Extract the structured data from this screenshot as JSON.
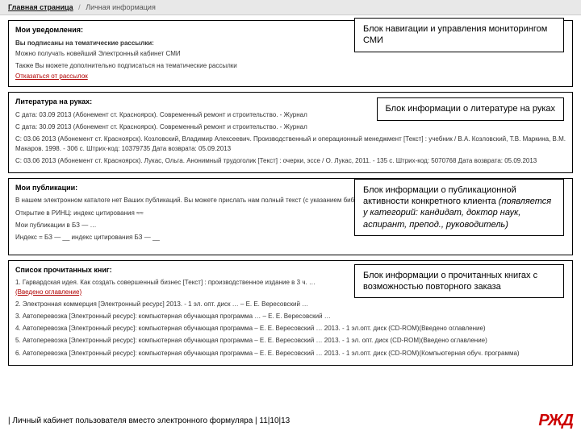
{
  "breadcrumb": {
    "main": "Главная страница",
    "current": "Личная информация"
  },
  "nav": {
    "title": "Мои уведомления:",
    "l1": "Вы подписаны на тематические рассылки:",
    "l2": "Можно получать новейший Электронный кабинет СМИ",
    "l3": "Также Вы можете дополнительно подписаться на тематические рассылки",
    "unsub": "Отказаться от рассылок",
    "label": "Блок навигации и управления мониторингом СМИ"
  },
  "lit": {
    "title": "Литература на руках:",
    "e1": "С дата: 03.09 2013 (Абонемент ст. Красноярск). Современный ремонт и строительство. - Журнал",
    "e2": "С дата: 30.09 2013 (Абонемент ст. Красноярск). Современный ремонт и строительство. - Журнал",
    "e3": "С: 03.06 2013 (Абонемент ст. Красноярск). Козловский, Владимир Алексеевич. Производственный и операционный менеджмент [Текст] : учебник / В.А. Козловский, Т.В. Маркина, В.М. Макаров. 1998. - 306 с. Штрих-код: 10379735 Дата возврата: 05.09.2013",
    "e4": "С: 03.06 2013 (Абонемент ст. Красноярск). Лукас, Ольга. Анонимный трудоголик [Текст] : очерки, эссе / О. Лукас, 2011. - 135 с. Штрих-код: 5070768 Дата возврата: 05.09.2013",
    "label": "Блок информации о литературе на руках"
  },
  "pub": {
    "title": "Мои публикации:",
    "l1": "В нашем электронном каталоге нет Ваших публикаций. Вы можете прислать нам полный текст (с указанием библиографии БЗ)",
    "l2": "Открытие в РИНЦ: индекс цитирования ≈≈",
    "l3": "Мои публикации в БЗ — …",
    "l4": "Индекс = БЗ — __ индекс цитирования БЗ — __",
    "label_t": "Блок информации о публикационной активности конкретного клиента ",
    "label_i": "(появляется у категорий: кандидат, доктор наук, аспирант, препод., руководитель)"
  },
  "read": {
    "title": "Список прочитанных книг:",
    "e1": "1. Гарвардская идея. Как создать совершенный бизнес [Текст] : производственное издание в 3 ч. …",
    "e1b": "(Введено оглавление)",
    "e2": "2. Электронная коммерция [Электронный ресурс] 2013. - 1 эл. опт. диск … – Е. Е. Вересовский …",
    "e3": "3. Автоперевозка [Электронный ресурс]: компьютерная обучающая программа … – Е. Е. Вересовский …",
    "e4": "4. Автоперевозка [Электронный ресурс]: компьютерная обучающая программа – Е. Е. Вересовский … 2013. - 1 эл.опт. диск (CD-ROM)(Введено оглавление)",
    "e5": "5. Автоперевозка [Электронный ресурс]: компьютерная обучающая программа – Е. Е. Вересовский … 2013. - 1 эл. опт. диск (CD-ROM)(Введено оглавление)",
    "e6": "6. Автоперевозка [Электронный ресурс]: компьютерная обучающая программа – Е. Е. Вересовский … 2013. - 1 эл.опт. диск (CD-ROM)(Компьютерная обуч. программа)",
    "label": "Блок информации о прочитанных книгах с возможностью повторного заказа"
  },
  "footer": {
    "text": "| Личный кабинет пользователя вместо электронного формуляра | 11|10|13",
    "logo": "РЖД"
  }
}
